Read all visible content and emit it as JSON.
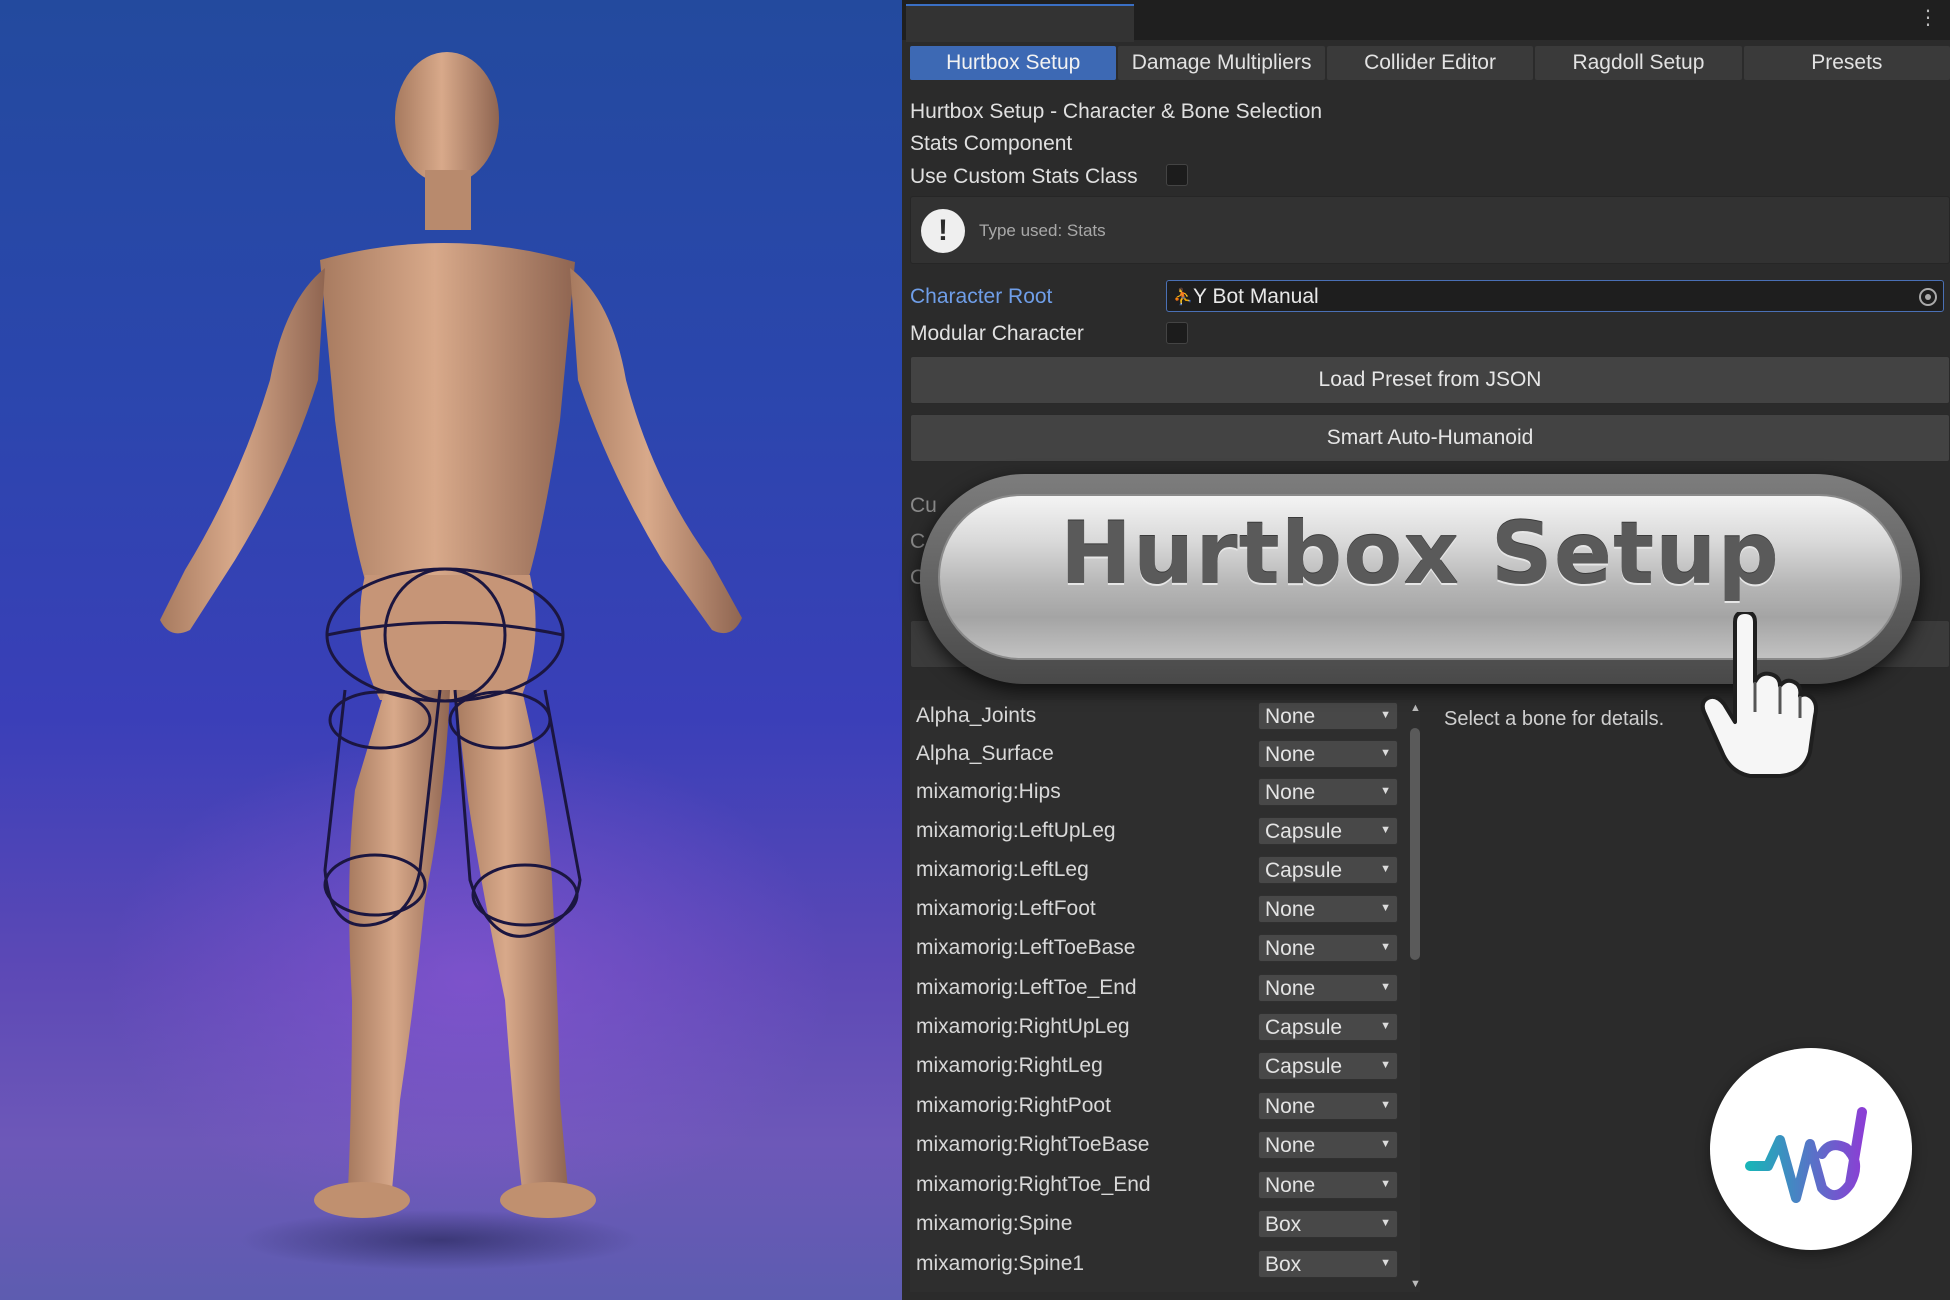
{
  "tabs": [
    "Hurtbox Setup",
    "Damage Multipliers",
    "Collider Editor",
    "Ragdoll Setup",
    "Presets"
  ],
  "section": {
    "heading": "Hurtbox Setup - Character & Bone Selection",
    "stats_component": "Stats Component",
    "use_custom_stats_label": "Use Custom Stats Class",
    "help_text": "Type used: Stats"
  },
  "character_root": {
    "label": "Character Root",
    "value": "Y Bot Manual"
  },
  "modular_character_label": "Modular Character",
  "buttons": {
    "load_preset": "Load Preset from JSON",
    "smart_auto": "Smart Auto-Humanoid"
  },
  "partial_rows": [
    "Cu",
    "C",
    "C"
  ],
  "banner_text": "Hurtbox Setup",
  "details_text": "Select a bone for details.",
  "bones": [
    {
      "name": "Alpha_Joints",
      "type": "None"
    },
    {
      "name": "Alpha_Surface",
      "type": "None"
    },
    {
      "name": "mixamorig:Hips",
      "type": "None"
    },
    {
      "name": "mixamorig:LeftUpLeg",
      "type": "Capsule"
    },
    {
      "name": "mixamorig:LeftLeg",
      "type": "Capsule"
    },
    {
      "name": "mixamorig:LeftFoot",
      "type": "None"
    },
    {
      "name": "mixamorig:LeftToeBase",
      "type": "None"
    },
    {
      "name": "mixamorig:LeftToe_End",
      "type": "None"
    },
    {
      "name": "mixamorig:RightUpLeg",
      "type": "Capsule"
    },
    {
      "name": "mixamorig:RightLeg",
      "type": "Capsule"
    },
    {
      "name": "mixamorig:RightPoot",
      "type": "None"
    },
    {
      "name": "mixamorig:RightToeBase",
      "type": "None"
    },
    {
      "name": "mixamorig:RightToe_End",
      "type": "None"
    },
    {
      "name": "mixamorig:Spine",
      "type": "Box"
    },
    {
      "name": "mixamorig:Spine1",
      "type": "Box"
    }
  ],
  "colors": {
    "accent": "#3d69b4",
    "link": "#6f9ee8",
    "panel": "#2b2b2b",
    "logo_teal": "#1ab3b8",
    "logo_purple": "#8a3fd4"
  }
}
